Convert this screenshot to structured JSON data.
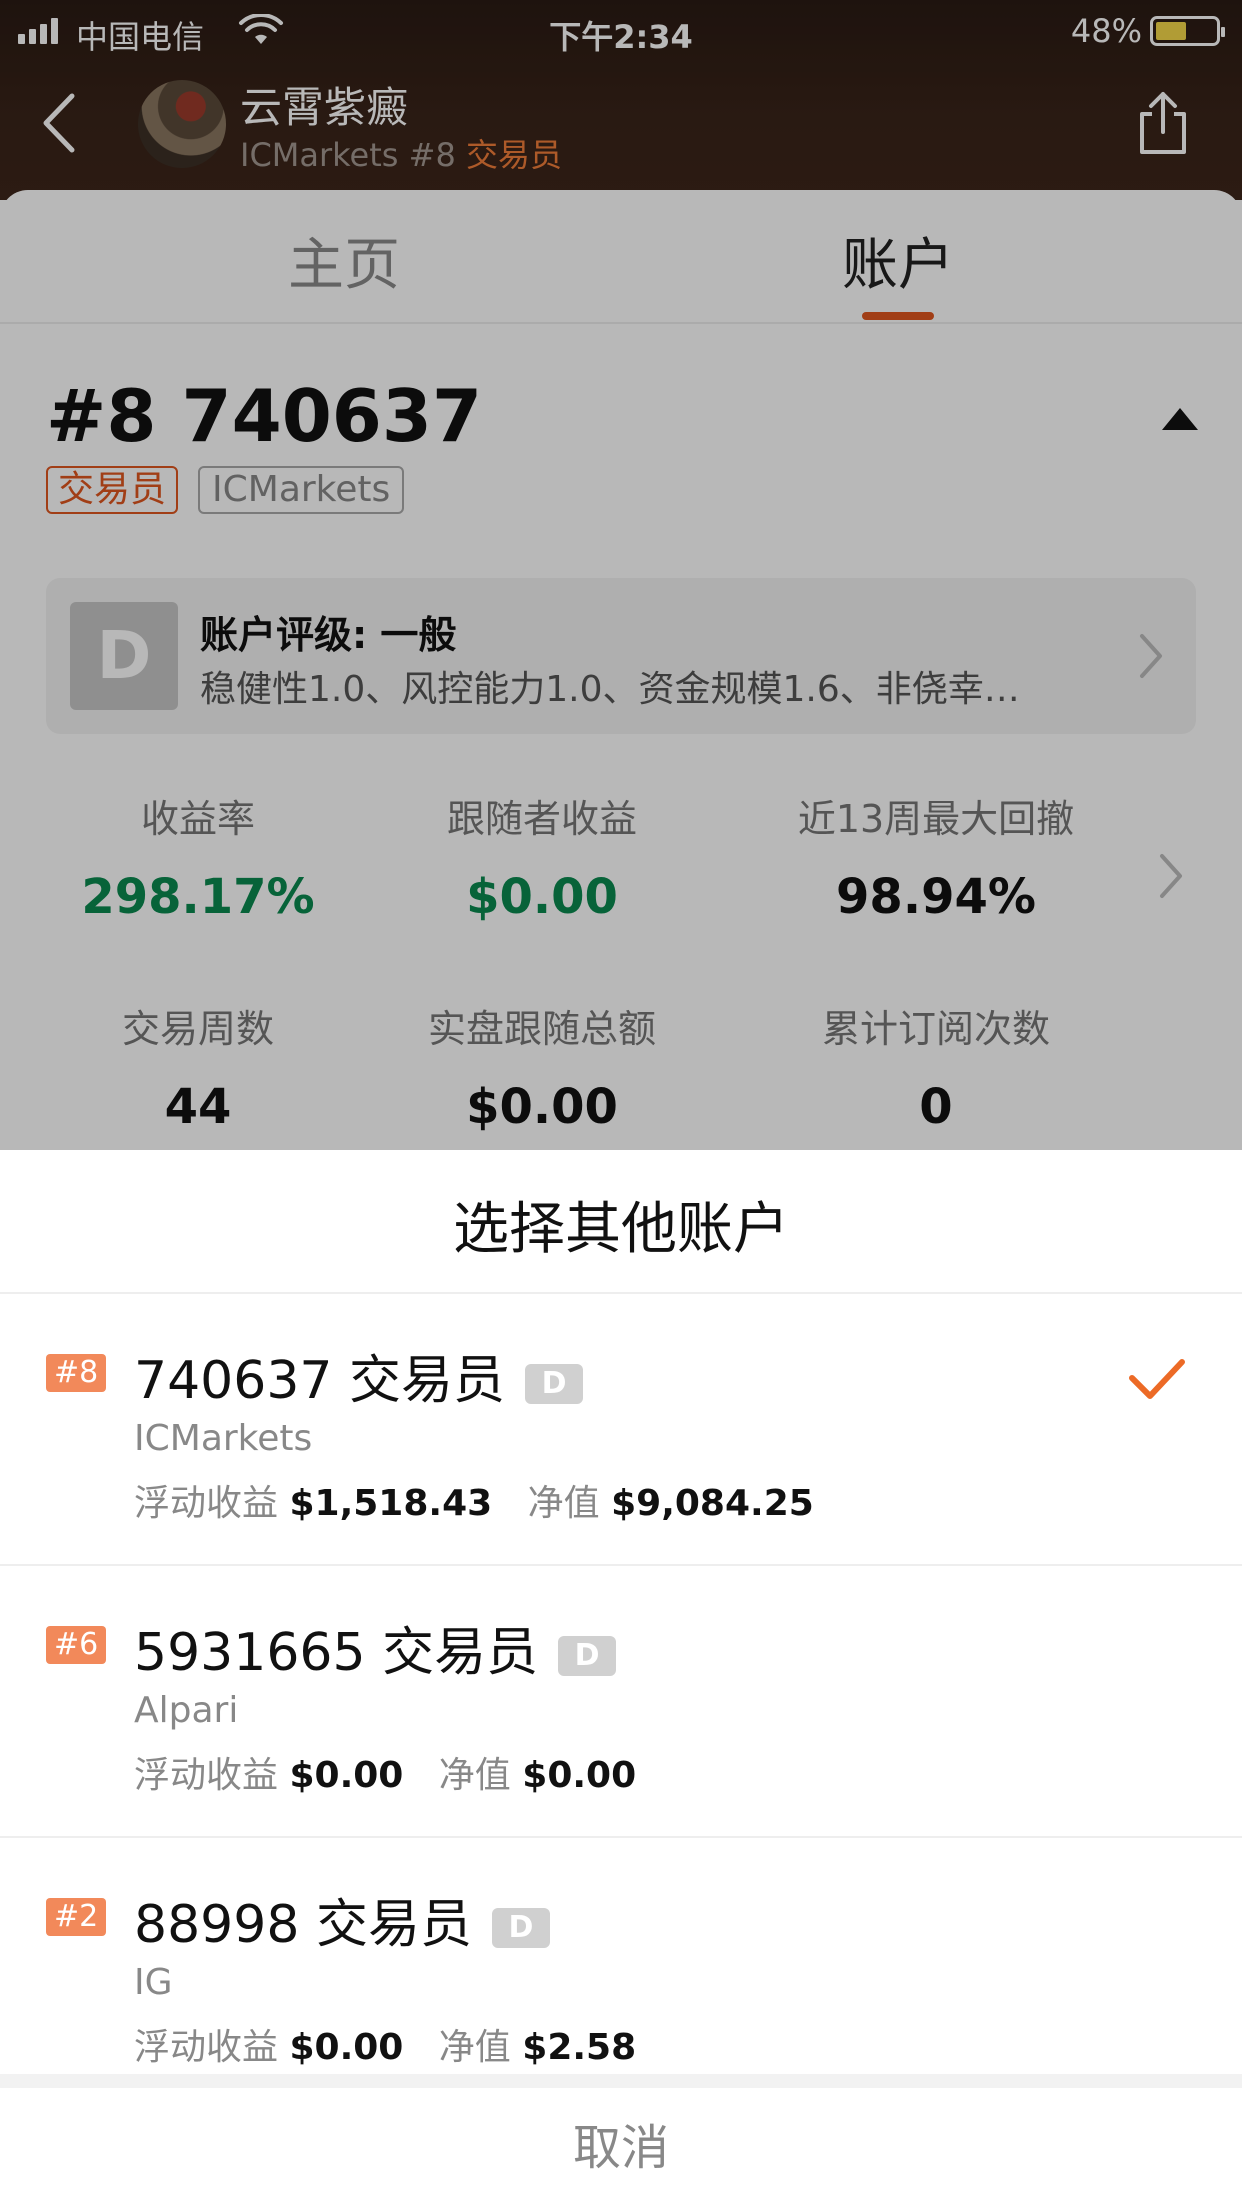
{
  "status_bar": {
    "carrier": "中国电信",
    "time": "下午2:34",
    "battery": "48%"
  },
  "header": {
    "user_name": "云霄紫癜",
    "broker": "ICMarkets",
    "rank": "#8",
    "role": "交易员"
  },
  "tabs": [
    {
      "label": "主页",
      "active": false
    },
    {
      "label": "账户",
      "active": true
    }
  ],
  "account": {
    "number": "#8 740637",
    "tag_role": "交易员",
    "tag_broker": "ICMarkets",
    "rating_badge": "D",
    "rating_title": "账户评级: 一般",
    "rating_desc": "稳健性1.0、风控能力1.0、资金规模1.6、非侥幸…"
  },
  "stats": [
    {
      "label": "收益率",
      "value": "298.17%",
      "color": "#0b8a4f"
    },
    {
      "label": "跟随者收益",
      "value": "$0.00",
      "color": "#0b8a4f"
    },
    {
      "label": "近13周最大回撤",
      "value": "98.94%",
      "color": "#111111"
    },
    {
      "label": "交易周数",
      "value": "44",
      "color": "#111111"
    },
    {
      "label": "实盘跟随总额",
      "value": "$0.00",
      "color": "#111111"
    },
    {
      "label": "累计订阅次数",
      "value": "0",
      "color": "#111111"
    }
  ],
  "sheet": {
    "title": "选择其他账户",
    "float_label": "浮动收益",
    "equity_label": "净值",
    "cancel": "取消",
    "accounts": [
      {
        "rank": "#8",
        "title": "740637 交易员",
        "level": "D",
        "broker": "ICMarkets",
        "float": "$1,518.43",
        "equity": "$9,084.25",
        "selected": true
      },
      {
        "rank": "#6",
        "title": "5931665 交易员",
        "level": "D",
        "broker": "Alpari",
        "float": "$0.00",
        "equity": "$0.00",
        "selected": false
      },
      {
        "rank": "#2",
        "title": "88998 交易员",
        "level": "D",
        "broker": "IG",
        "float": "$0.00",
        "equity": "$2.58",
        "selected": false
      }
    ]
  },
  "colors": {
    "accent": "#e0561f",
    "rank_badge": "#f2895a",
    "positive": "#0b8a4f"
  }
}
